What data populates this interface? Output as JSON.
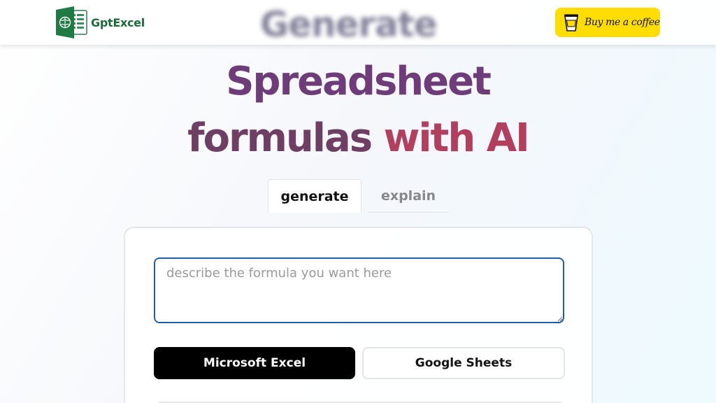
{
  "header": {
    "logo_text": "GptExcel",
    "ghost_word": "Generate",
    "coffee_label": "Buy me a coffee"
  },
  "hero": {
    "line1": "Spreadsheet",
    "line2_part1": "formulas",
    "line2_part2": "with AI"
  },
  "tabs": [
    {
      "label": "generate",
      "active": true
    },
    {
      "label": "explain",
      "active": false
    }
  ],
  "form": {
    "prompt_placeholder": "describe the formula you want here",
    "prompt_value": "",
    "platforms": [
      {
        "label": "Microsoft Excel",
        "selected": true
      },
      {
        "label": "Google Sheets",
        "selected": false
      }
    ]
  },
  "colors": {
    "logo_green": "#1e6b3a",
    "coffee_yellow": "#ffdd00",
    "hero_purple": "#6d3c79",
    "hero_rose": "#b23f5e",
    "input_border": "#1f5fae"
  },
  "icons": {
    "logo": "excel-brain-icon",
    "coffee": "coffee-cup-icon"
  }
}
